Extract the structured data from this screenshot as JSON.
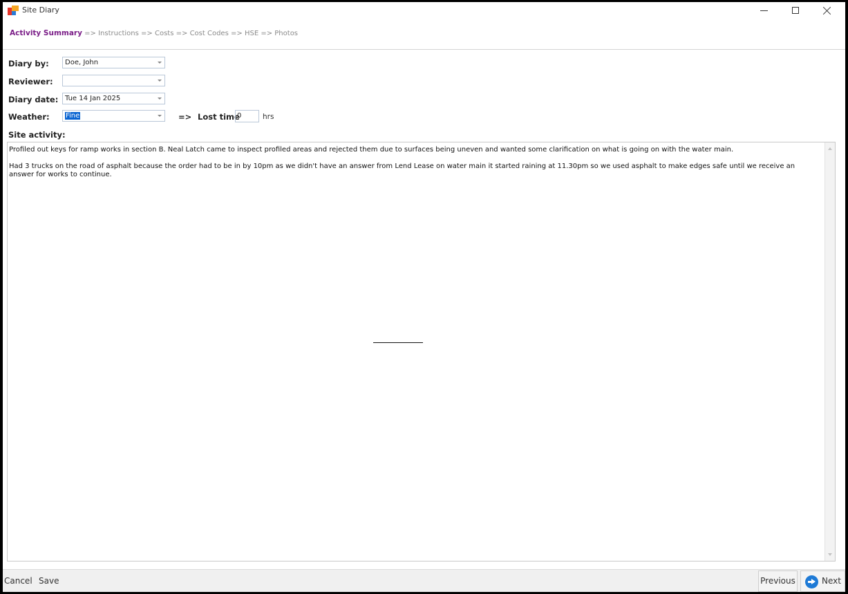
{
  "window": {
    "title": "Site Diary"
  },
  "breadcrumb": {
    "items": [
      "Activity Summary",
      "Instructions",
      "Costs",
      "Cost Codes",
      "HSE",
      "Photos"
    ],
    "separator": "=>"
  },
  "form": {
    "diary_by": {
      "label": "Diary by:",
      "value": "Doe, John"
    },
    "reviewer": {
      "label": "Reviewer:",
      "value": ""
    },
    "diary_date": {
      "label": "Diary date:",
      "value": "Tue 14 Jan 2025"
    },
    "weather": {
      "label": "Weather:",
      "value": "Fine"
    },
    "lost_time": {
      "arrow": "=>",
      "label": "Lost time",
      "value": "0",
      "unit": "hrs"
    },
    "site_activity": {
      "label": "Site activity:",
      "text": "Profiled out keys for ramp works in section B. Neal Latch came to inspect profiled areas and rejected them due to surfaces being uneven and wanted some clarification on what is going on with the water main.\n\nHad 3 trucks on the road of asphalt because the order had to be in by 10pm as we didn't have an answer from Lend Lease on water main it started raining at 11.30pm so we used asphalt to make edges safe until we receive an answer for works to continue."
    }
  },
  "footer": {
    "cancel": "Cancel",
    "save": "Save",
    "previous": "Previous",
    "next": "Next"
  },
  "colors": {
    "breadcrumb_active": "#7b1e88",
    "selection": "#0a64d2",
    "next_icon": "#1e7ad6"
  }
}
